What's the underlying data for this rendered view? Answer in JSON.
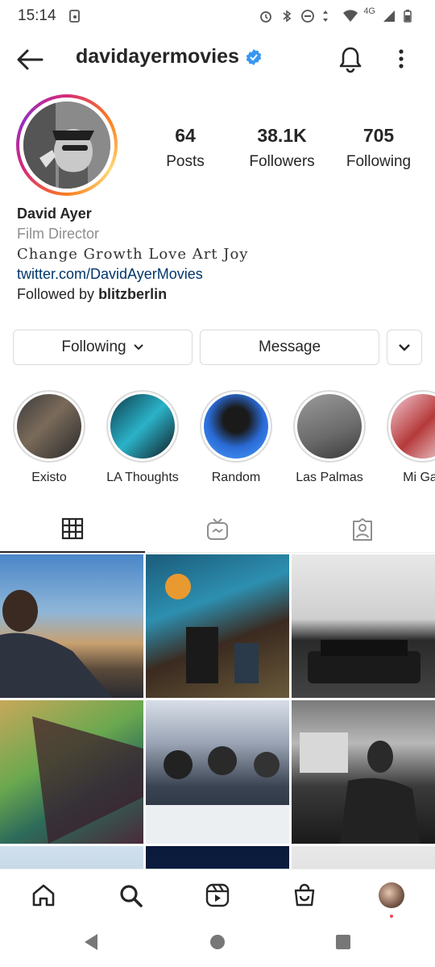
{
  "status_bar": {
    "time": "15:14",
    "network": "4G"
  },
  "header": {
    "username": "davidayermovies"
  },
  "profile": {
    "stats": [
      {
        "value": "64",
        "label": "Posts"
      },
      {
        "value": "38.1K",
        "label": "Followers"
      },
      {
        "value": "705",
        "label": "Following"
      }
    ],
    "name": "David Ayer",
    "category": "Film Director",
    "tagline": "Change Growth Love Art Joy",
    "link": "twitter.com/DavidAyerMovies",
    "followed_by_prefix": "Followed by ",
    "followed_by_user": "blitzberlin"
  },
  "buttons": {
    "following": "Following",
    "message": "Message"
  },
  "highlights": [
    {
      "label": "Existo"
    },
    {
      "label": "LA Thoughts"
    },
    {
      "label": "Random"
    },
    {
      "label": "Las Palmas"
    },
    {
      "label": "Mi Gall"
    }
  ],
  "icons": {
    "back": "arrow-left-icon",
    "verified": "verified-badge-icon",
    "bell": "bell-icon",
    "more": "more-vertical-icon",
    "tab_grid": "grid-icon",
    "tab_igtv": "igtv-icon",
    "tab_tagged": "tagged-icon",
    "nav_home": "home-icon",
    "nav_search": "search-icon",
    "nav_reels": "reels-icon",
    "nav_shop": "shop-icon"
  },
  "colors": {
    "accent": "#3897f0",
    "link": "#00376b",
    "muted": "#8e8e8e",
    "notification_dot": "#ed4956"
  }
}
